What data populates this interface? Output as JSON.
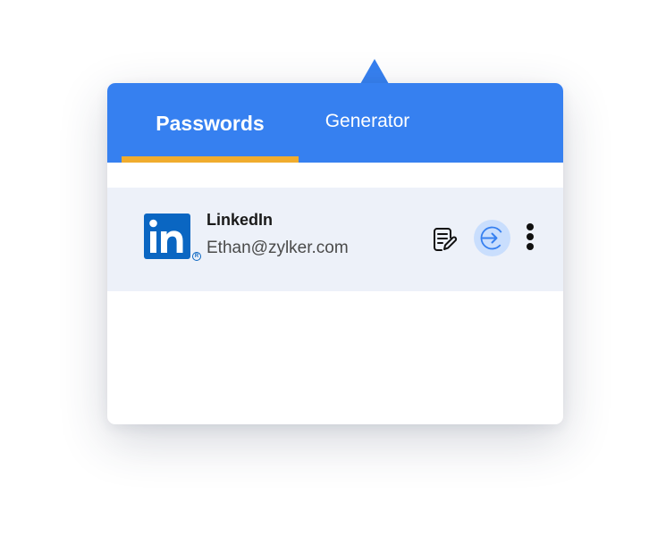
{
  "tabs": [
    {
      "label": "Passwords",
      "active": true
    },
    {
      "label": "Generator",
      "active": false
    }
  ],
  "entry": {
    "title": "LinkedIn",
    "email": "Ethan@zylker.com",
    "logo_text": "in",
    "logo_icon": "linkedin-logo-icon"
  },
  "actions": {
    "edit_icon": "note-edit-icon",
    "login_icon": "arrow-right-login-icon",
    "more_icon": "more-vertical-icon"
  },
  "colors": {
    "header": "#3680f0",
    "tab_indicator": "#f0ac2e",
    "row_background": "#edf1f9",
    "login_button": "#c9defd",
    "linkedin_blue": "#0a66c2"
  }
}
